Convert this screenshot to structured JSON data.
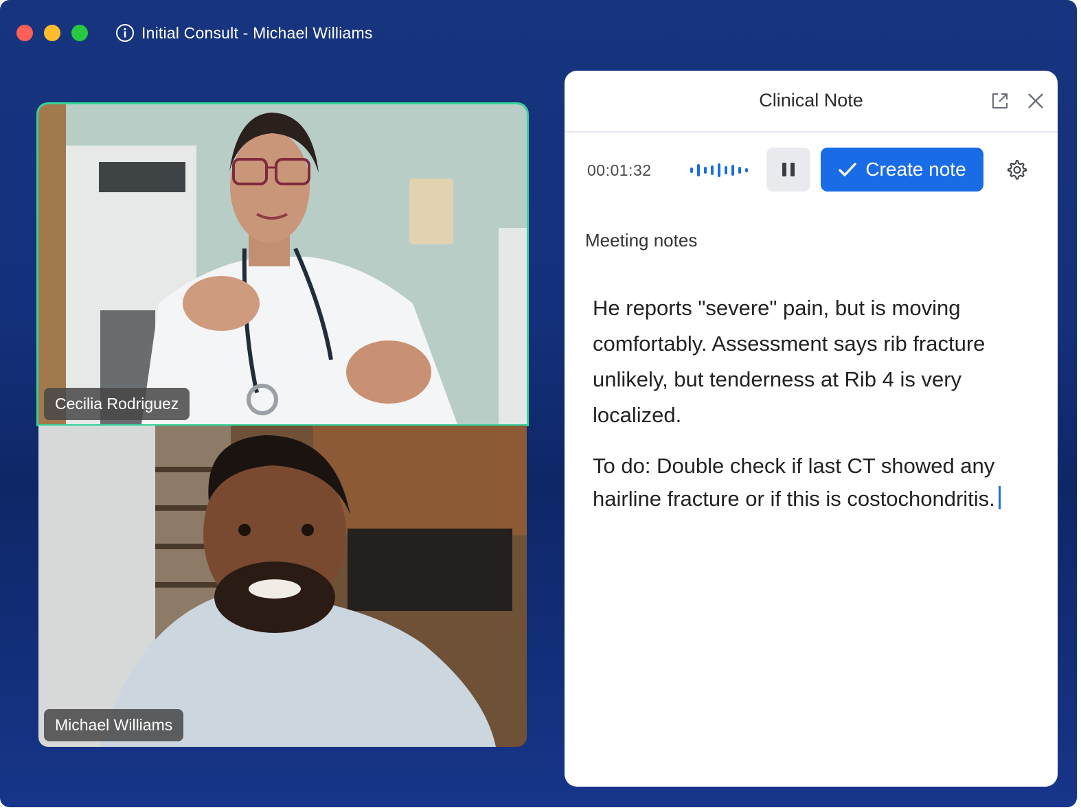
{
  "window": {
    "title": "Initial Consult - Michael Williams"
  },
  "participants": [
    {
      "name": "Cecilia Rodriguez",
      "active_speaker": true
    },
    {
      "name": "Michael Williams",
      "active_speaker": false
    }
  ],
  "panel": {
    "title": "Clinical Note",
    "timer": "00:01:32",
    "create_note_label": "Create note",
    "section_label": "Meeting notes",
    "note_paragraphs": [
      "He reports \"severe\" pain, but is moving comfortably. Assessment says rib fracture unlikely, but tenderness at Rib 4 is very localized.",
      "To do: Double check if last CT showed any hairline fracture or if this is costochondritis."
    ]
  },
  "icons": {
    "title": "info-icon",
    "popout": "external-link-icon",
    "close": "close-icon",
    "recording": "audio-wave-icon",
    "pause": "pause-icon",
    "create": "checkmark-icon",
    "settings": "gear-icon"
  },
  "colors": {
    "background": "#14307a",
    "accent": "#1a6ce6",
    "active_speaker_border": "#34d399"
  }
}
